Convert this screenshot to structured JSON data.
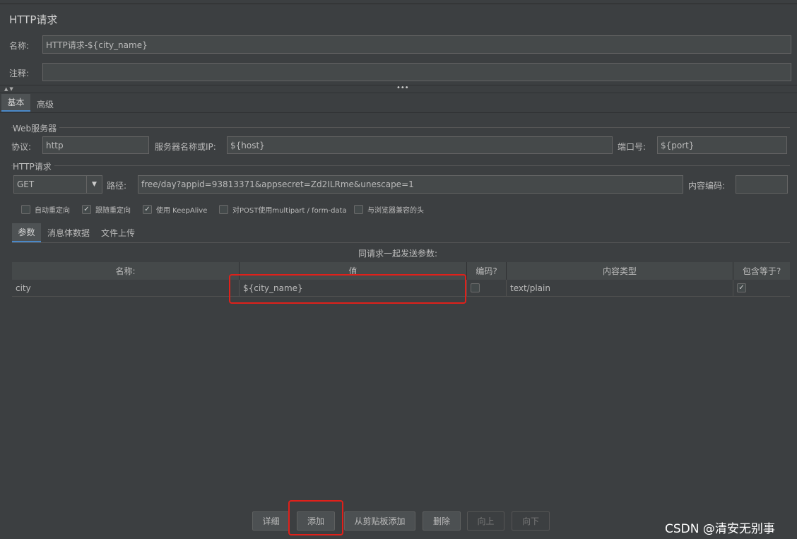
{
  "title": "HTTP请求",
  "name": {
    "label": "名称:",
    "value": "HTTP请求-${city_name}"
  },
  "comment": {
    "label": "注释:",
    "value": ""
  },
  "tabs": [
    "基本",
    "高级"
  ],
  "web_server": {
    "group_title": "Web服务器",
    "protocol_label": "协议:",
    "protocol_value": "http",
    "server_label": "服务器名称或IP:",
    "server_value": "${host}",
    "port_label": "端口号:",
    "port_value": "${port}"
  },
  "http_request": {
    "group_title": "HTTP请求",
    "method": "GET",
    "path_label": "路径:",
    "path_value": "free/day?appid=93813371&appsecret=Zd2ILRme&unescape=1",
    "encoding_label": "内容编码:",
    "encoding_value": ""
  },
  "options": [
    {
      "label": "自动重定向",
      "checked": false
    },
    {
      "label": "跟随重定向",
      "checked": true
    },
    {
      "label": "使用 KeepAlive",
      "checked": true
    },
    {
      "label": "对POST使用multipart / form-data",
      "checked": false
    },
    {
      "label": "与浏览器兼容的头",
      "checked": false
    }
  ],
  "sub_tabs": [
    "参数",
    "消息体数据",
    "文件上传"
  ],
  "params_caption": "同请求一起发送参数:",
  "table": {
    "headers": [
      "名称:",
      "值",
      "编码?",
      "内容类型",
      "包含等于?"
    ],
    "rows": [
      {
        "name": "city",
        "value": "${city_name}",
        "encode": false,
        "content_type": "text/plain",
        "include_equals": true
      }
    ]
  },
  "buttons": {
    "detail": "详细",
    "add": "添加",
    "add_clipboard": "从剪贴板添加",
    "delete": "删除",
    "up": "向上",
    "down": "向下"
  },
  "watermark": "CSDN @清安无别事",
  "check_glyph": "✓",
  "colors": {
    "background": "#3c3f41",
    "highlight_box": "#e0201a",
    "tab_accent": "#4a88c7"
  }
}
